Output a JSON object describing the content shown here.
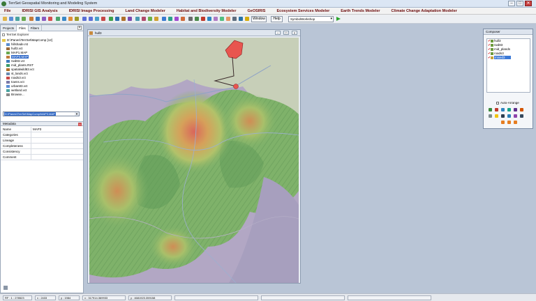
{
  "window": {
    "title": "TerrSet Geospatial Monitoring and Modeling System",
    "controls": [
      "–",
      "□",
      "✕"
    ]
  },
  "menu": [
    "File",
    "IDRISI GIS Analysis",
    "IDRISI Image Processing",
    "Land Change Modeler",
    "Habitat and Biodiversity Modeler",
    "GeOSIRIS",
    "Ecosystem Services Modeler",
    "Earth Trends Modeler",
    "Climate Change Adaptation Modeler"
  ],
  "toolbar": {
    "window_label": "Window",
    "help_label": "Help",
    "symbol_select": "SymbolWorkshop"
  },
  "explorer": {
    "tabs": [
      "Projects",
      "Files",
      "Filters"
    ],
    "active_tab": "Files",
    "title": "TerrSet Explorer",
    "root_folder": "D:\\Panes\\TerrSet\\MapComp [12]",
    "files": [
      "hillshade.rst",
      "hull3.vct",
      "MAP1.MAP",
      "MAP3.MAP",
      "rwd83.vct",
      "mid_plants.RST",
      "spatialwild83.vct",
      "st_lands.vct",
      "roads3.vct",
      "towns.vct",
      "urban83.vct",
      "wetland.vct",
      "Browse..."
    ],
    "selected_file": "MAP3.MAP",
    "path_value": "D:\\Panes\\TerrSet\\MapComp\\MAP3.MAP",
    "metadata_title": "Metadata",
    "metadata": [
      {
        "k": "Name",
        "v": "MAP3"
      },
      {
        "k": "Categories",
        "v": ""
      },
      {
        "k": "Lineage",
        "v": ""
      },
      {
        "k": "Completeness",
        "v": ""
      },
      {
        "k": "Consistency",
        "v": ""
      },
      {
        "k": "Comment",
        "v": ""
      }
    ]
  },
  "mapwindow": {
    "title": "hull3"
  },
  "composer": {
    "title": "Composer",
    "layers": [
      {
        "name": "hull3",
        "color": "#6c9a3c"
      },
      {
        "name": "rwd83",
        "color": "#6c9a3c"
      },
      {
        "name": "mid_plands",
        "color": "#6c9a3c"
      },
      {
        "name": "roads3",
        "color": "#6c9a3c"
      },
      {
        "name": "mixed3",
        "color": "#c8a43c"
      }
    ],
    "selected_layer": "mixed3",
    "auto_arrange_label": "Auto-Arrange"
  },
  "status": {
    "rf": "RF : 1 : 278523",
    "x": "x : 2433",
    "y": "y : 1984",
    "xcoord": "x : 317914.369933",
    "ycoord": "y : 4681923.359158"
  },
  "colors": {
    "menu_text": "#6b0a0a",
    "selection": "#3069c8",
    "vector_red": "#e8554f"
  }
}
